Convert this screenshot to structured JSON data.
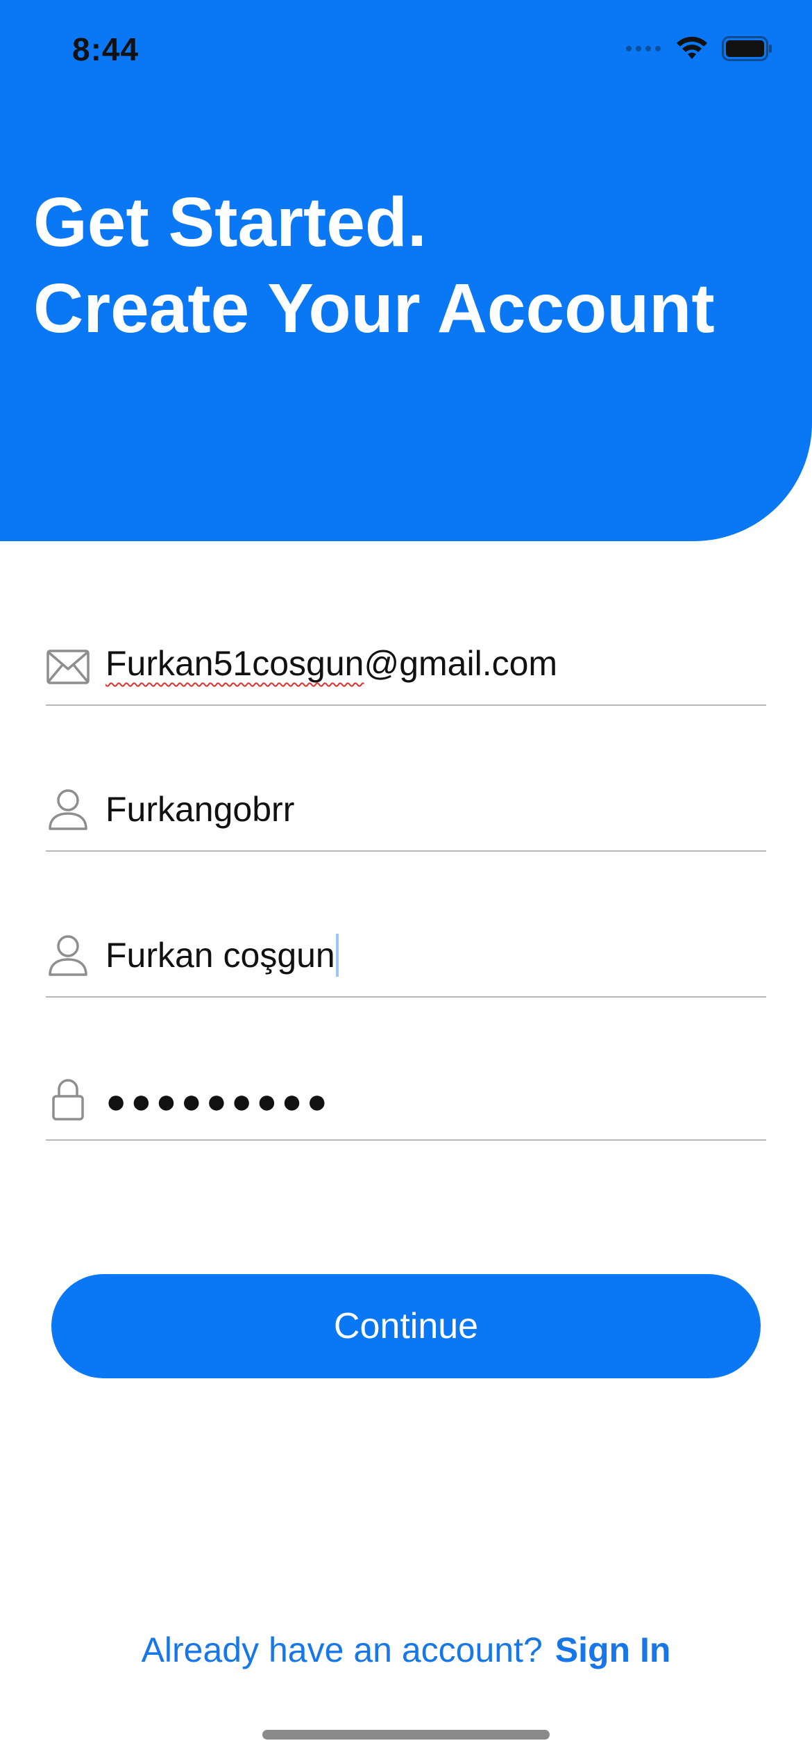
{
  "status_bar": {
    "time": "8:44",
    "icons": [
      "signal-dots-icon",
      "wifi-icon",
      "battery-icon"
    ]
  },
  "header": {
    "line1": "Get Started.",
    "line2": "Create Your Account"
  },
  "form": {
    "email": {
      "icon": "mail-icon",
      "value_spelled": "Furkan51cosgun",
      "value_rest": "@gmail.com"
    },
    "username": {
      "icon": "person-icon",
      "value": "Furkangobrr"
    },
    "fullname": {
      "icon": "person-icon",
      "value": "Furkan coşgun"
    },
    "password": {
      "icon": "lock-icon",
      "value": "●●●●●●●●●"
    }
  },
  "actions": {
    "continue_label": "Continue",
    "prompt": "Already have an account?",
    "signin_label": "Sign In"
  },
  "colors": {
    "accent": "#0A78F4",
    "link": "#1877E8",
    "divider": "#B9B9B9"
  }
}
